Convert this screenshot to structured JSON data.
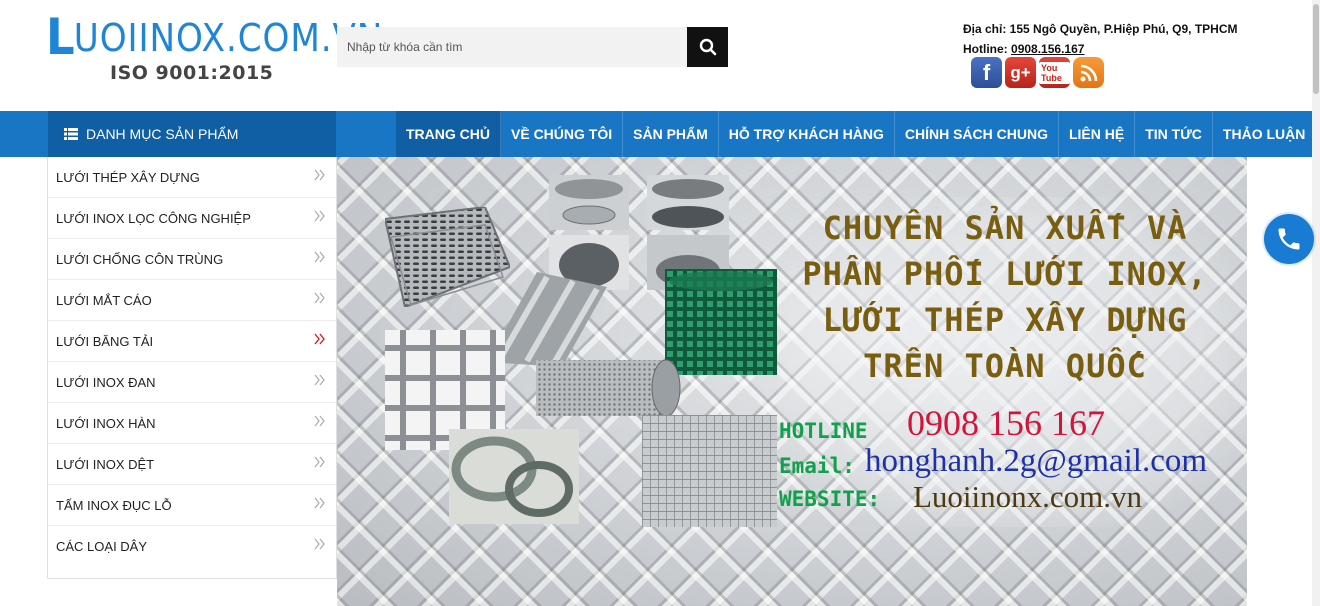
{
  "logo": {
    "first_letter": "L",
    "rest": "uoiinox.com.vn",
    "tagline": "ISO 9001:2015"
  },
  "search": {
    "placeholder": "Nhập từ khóa cần tìm",
    "icon": "search-icon"
  },
  "contact": {
    "address": "Địa chỉ: 155 Ngô Quyền, P.Hiệp Phú, Q9, TPHCM",
    "hotline_label": "Hotline:",
    "hotline_number": "0908.156.167"
  },
  "socials": [
    "facebook",
    "google-plus",
    "youtube",
    "blogger"
  ],
  "social_text": {
    "facebook": "f",
    "google_plus": "g+",
    "youtube": "You Tube"
  },
  "nav": {
    "category_title": "DANH MỤC SẢN PHẨM",
    "menu": [
      {
        "label": "TRANG CHỦ",
        "active": true
      },
      {
        "label": "VỀ CHÚNG TÔI"
      },
      {
        "label": "SẢN PHẨM"
      },
      {
        "label": "HỖ TRỢ KHÁCH HÀNG"
      },
      {
        "label": "CHÍNH SÁCH CHUNG"
      },
      {
        "label": "LIÊN HỆ"
      },
      {
        "label": "TIN TỨC"
      },
      {
        "label": "THẢO LUẬN"
      }
    ]
  },
  "sidebar": {
    "items": [
      {
        "label": "LƯỚI THÉP XÂY DỰNG"
      },
      {
        "label": "LƯỚI INOX LỌC CÔNG NGHIỆP"
      },
      {
        "label": "LƯỚI CHỐNG CÔN TRÙNG"
      },
      {
        "label": "LƯỚI MẮT CÁO"
      },
      {
        "label": "LƯỚI BĂNG TẢI",
        "highlight": true
      },
      {
        "label": "LƯỚI INOX ĐAN"
      },
      {
        "label": "LƯỚI INOX HÀN"
      },
      {
        "label": "LƯỚI INOX DỆT"
      },
      {
        "label": "TẤM INOX ĐỤC LỖ"
      },
      {
        "label": "CÁC LOẠI DÂY"
      }
    ]
  },
  "banner": {
    "headline": [
      "CHUYÊN SẢN XUẤT VÀ",
      "PHÂN PHỐI LƯỚI INOX,",
      "LƯỚI THÉP XÂY DỰNG",
      "TRÊN TOÀN QUỐC"
    ],
    "hotline_label": "HOTLINE",
    "hotline_value": "0908 156 167",
    "email_label": "Email:",
    "email_value": "honghanh.2g@gmail.com",
    "website_label": "WEBSITE:",
    "website_value": "Luoiinonx.com.vn"
  },
  "colors": {
    "brand_blue": "#1976c4",
    "nav_dark": "#105ea3",
    "headline": "#7a5e10",
    "hotline_red": "#d4123a",
    "label_green": "#11a14a",
    "email_blue": "#1d31a8"
  }
}
